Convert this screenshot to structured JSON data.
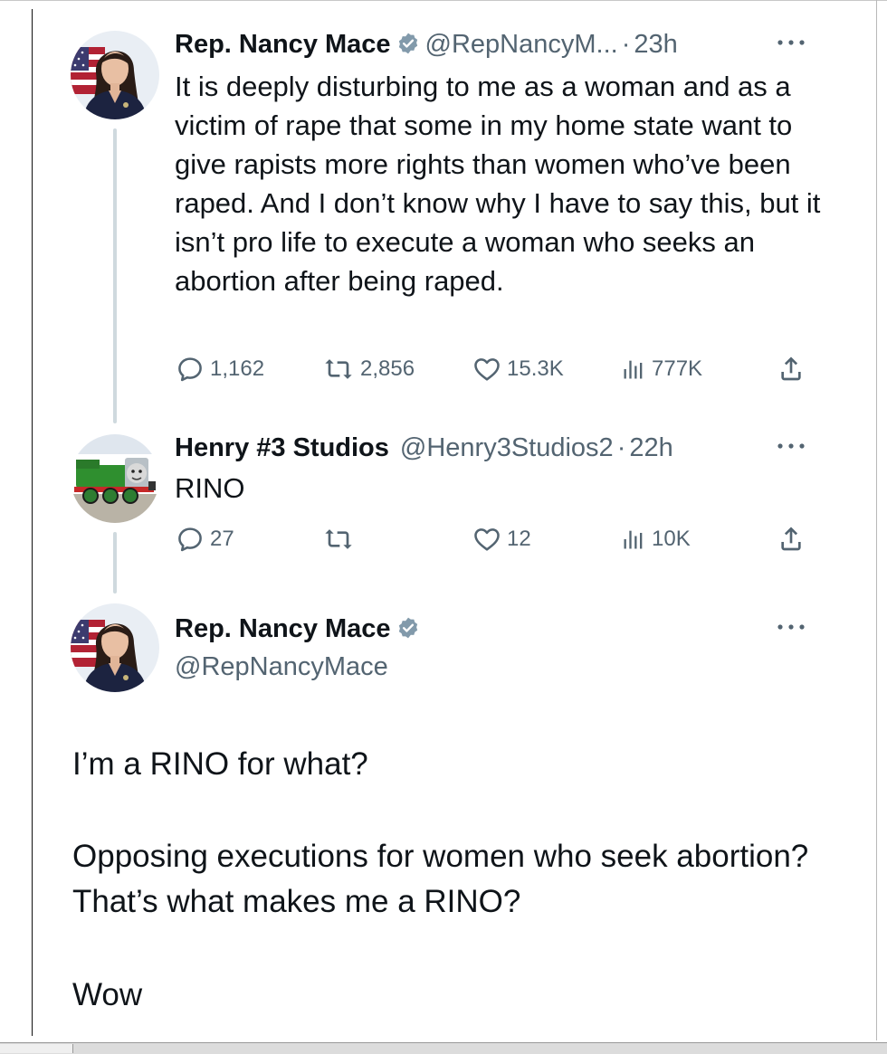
{
  "tweets": [
    {
      "name": "Rep. Nancy Mace",
      "handle": "@RepNancyM...",
      "time": "23h",
      "text": "It is deeply disturbing to me as a woman and as a victim of rape that some in my home state want to give rapists more rights than women who’ve been raped. And I don’t know why I have to say this, but it isn’t pro life to execute a woman who seeks an abortion after being raped.",
      "replies": "1,162",
      "retweets": "2,856",
      "likes": "15.3K",
      "views": "777K"
    },
    {
      "name": "Henry #3 Studios",
      "handle": "@Henry3Studios2",
      "time": "22h",
      "text": "RINO",
      "replies": "27",
      "retweets": "",
      "likes": "12",
      "views": "10K"
    }
  ],
  "main_tweet": {
    "name": "Rep. Nancy Mace",
    "handle": "@RepNancyMace",
    "paragraphs": [
      "I’m a RINO for what?",
      "Opposing executions for women who seek abortion? That’s what makes me a RINO?",
      "Wow"
    ]
  },
  "separator": "·",
  "colors": {
    "text": "#0f1419",
    "secondary": "#536471",
    "verified": "#829aab",
    "thread_line": "#cfd9de"
  },
  "icons": [
    "reply-icon",
    "retweet-icon",
    "like-icon",
    "views-icon",
    "share-icon",
    "more-icon",
    "verified-badge-icon"
  ]
}
